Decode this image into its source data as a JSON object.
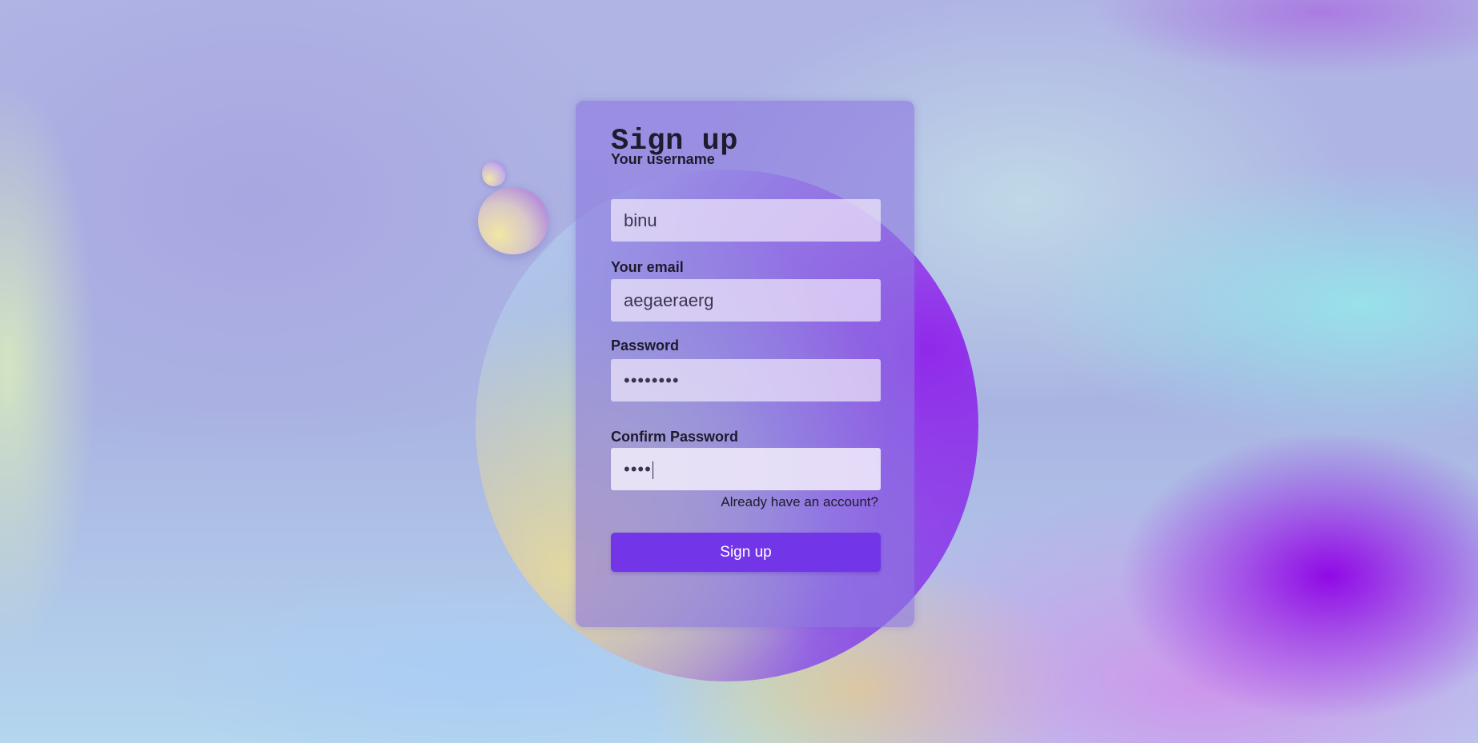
{
  "form": {
    "title": "Sign up",
    "username": {
      "label": "Your username",
      "value": "binu"
    },
    "email": {
      "label": "Your email",
      "value": "aegaeraerg"
    },
    "password": {
      "label": "Password",
      "value": "••••••••"
    },
    "confirm_password": {
      "label": "Confirm Password",
      "value": "••••"
    },
    "login_link": "Already have an account?",
    "submit_label": "Sign up"
  },
  "colors": {
    "card_bg": "#8c78e1",
    "button_bg": "#7236e8",
    "accent_purple": "#8e00e6"
  }
}
